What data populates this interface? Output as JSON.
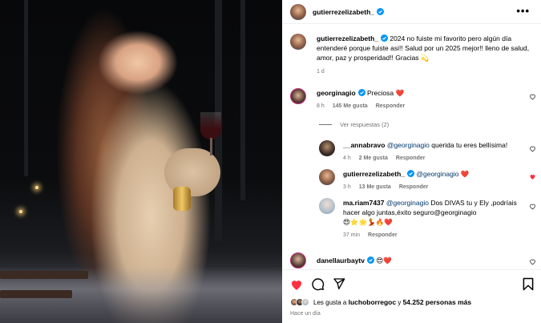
{
  "post": {
    "username": "gutierrezelizabeth_",
    "more_label": "•••"
  },
  "caption": {
    "username": "gutierrezelizabeth_",
    "text": "2024 no fuiste mi favorito pero algún día entenderé porque fuiste asi!! Salud por un 2025 mejor!! lleno de salud, amor, paz y prosperidad!! Gracias 💫",
    "time": "1 d"
  },
  "comments": [
    {
      "username": "georginagio",
      "text": "Preciosa ❤️",
      "time": "8 h",
      "likes": "145 Me gusta",
      "reply": "Responder"
    },
    {
      "username": "__annabravo",
      "mention": "@georginagio",
      "text": " querida tu eres bellísima!",
      "time": "4 h",
      "likes": "2 Me gusta",
      "reply": "Responder"
    },
    {
      "username": "gutierrezelizabeth_",
      "mention": "@georginagio",
      "text": " ❤️",
      "time": "3 h",
      "likes": "13 Me gusta",
      "reply": "Responder"
    },
    {
      "username": "ma.riam7437",
      "mention": "@georginagio",
      "text": " Dos DIVAS tu y Ely ,podríais hacer algo juntas,éxito seguro@georginagio",
      "emojis": "😍⭐🌟💃🔥❤️",
      "time": "37 min",
      "reply": "Responder"
    },
    {
      "username": "danellaurbaytv",
      "text": "😍❤️"
    }
  ],
  "view_replies": "Ver respuestas (2)",
  "likes": {
    "prefix": "Les gusta a ",
    "user": "luchoborregoc",
    "middle": " y ",
    "count": "54.252 personas más"
  },
  "posted_ago": "Hace un día",
  "colors": {
    "heart_red": "#ff3040",
    "verified_blue": "#0095f6",
    "meta_gray": "#737373"
  }
}
